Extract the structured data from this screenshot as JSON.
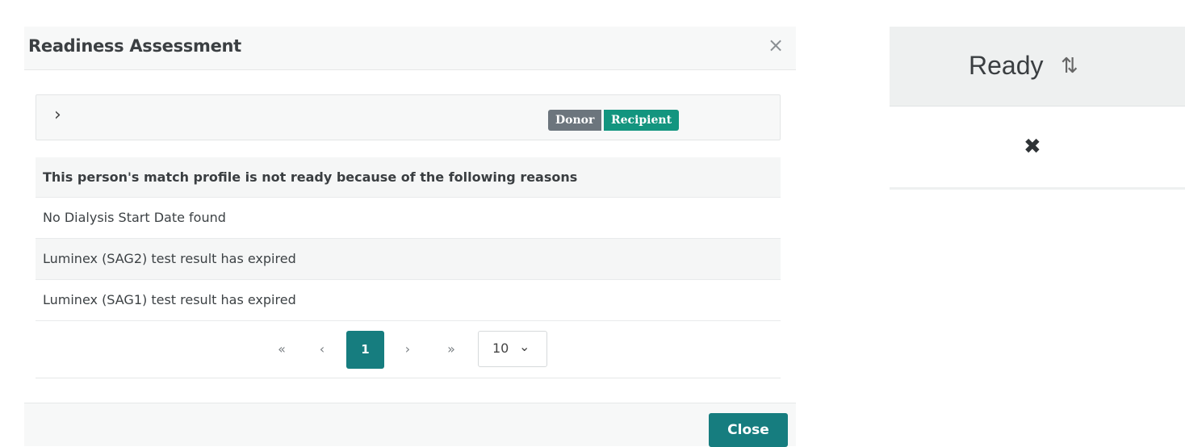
{
  "modal": {
    "title": "Readiness Assessment",
    "close_glyph": "×",
    "collapse_chevron": "›",
    "badges": {
      "donor": "Donor",
      "recipient": "Recipient"
    },
    "badge_colors": {
      "donor": "#6c757d",
      "recipient": "#13957f"
    },
    "reasons_header": "This person's match profile is not ready because of the following reasons",
    "reasons": [
      "No Dialysis Start Date found",
      "Luminex (SAG2) test result has expired",
      "Luminex (SAG1) test result has expired"
    ],
    "pagination": {
      "first": "«",
      "prev": "‹",
      "current_page": "1",
      "next": "›",
      "last": "»",
      "rows_per_page": "10",
      "rows_arrow": "⌄"
    },
    "footer": {
      "close_label": "Close"
    },
    "accent_color": "#167d7f"
  },
  "ready_column": {
    "header": "Ready",
    "sort_icon": "⇅",
    "cell_value": "✖"
  }
}
